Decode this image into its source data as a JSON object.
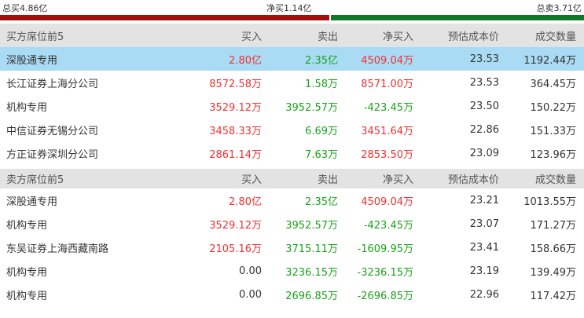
{
  "summary": {
    "total_buy": "总买4.86亿",
    "net_buy": "净买1.14亿",
    "total_sell": "总卖3.71亿",
    "buy_color": "#a50e0e",
    "sell_color": "#0d7a2a"
  },
  "buy_section": {
    "header": {
      "title": "买方席位前5",
      "col_buy": "买入",
      "col_sell": "卖出",
      "col_net": "净买入",
      "col_cost": "预估成本价",
      "col_volume": "成交数量"
    },
    "rows": [
      {
        "name": "深股通专用",
        "buy": "2.80亿",
        "sell": "2.35亿",
        "net": "4509.04万",
        "cost": "23.53",
        "volume": "1192.44万"
      },
      {
        "name": "长江证券上海分公司",
        "buy": "8572.58万",
        "sell": "1.58万",
        "net": "8571.00万",
        "cost": "23.53",
        "volume": "364.45万"
      },
      {
        "name": "机构专用",
        "buy": "3529.12万",
        "sell": "3952.57万",
        "net": "-423.45万",
        "cost": "23.50",
        "volume": "150.22万"
      },
      {
        "name": "中信证券无锡分公司",
        "buy": "3458.33万",
        "sell": "6.69万",
        "net": "3451.64万",
        "cost": "22.86",
        "volume": "151.33万"
      },
      {
        "name": "方正证券深圳分公司",
        "buy": "2861.14万",
        "sell": "7.63万",
        "net": "2853.50万",
        "cost": "23.09",
        "volume": "123.96万"
      }
    ]
  },
  "sell_section": {
    "header": {
      "title": "卖方席位前5",
      "col_buy": "买入",
      "col_sell": "卖出",
      "col_net": "净买入",
      "col_cost": "预估成本价",
      "col_volume": "成交数量"
    },
    "rows": [
      {
        "name": "深股通专用",
        "buy": "2.80亿",
        "sell": "2.35亿",
        "net": "4509.04万",
        "cost": "23.21",
        "volume": "1013.55万"
      },
      {
        "name": "机构专用",
        "buy": "3529.12万",
        "sell": "3952.57万",
        "net": "-423.45万",
        "cost": "23.07",
        "volume": "171.27万"
      },
      {
        "name": "东吴证券上海西藏南路",
        "buy": "2105.16万",
        "sell": "3715.11万",
        "net": "-1609.95万",
        "cost": "23.41",
        "volume": "158.66万"
      },
      {
        "name": "机构专用",
        "buy": "0.00",
        "sell": "3236.15万",
        "net": "-3236.15万",
        "cost": "23.19",
        "volume": "139.49万"
      },
      {
        "name": "机构专用",
        "buy": "0.00",
        "sell": "2696.85万",
        "net": "-2696.85万",
        "cost": "22.96",
        "volume": "117.42万"
      }
    ]
  }
}
